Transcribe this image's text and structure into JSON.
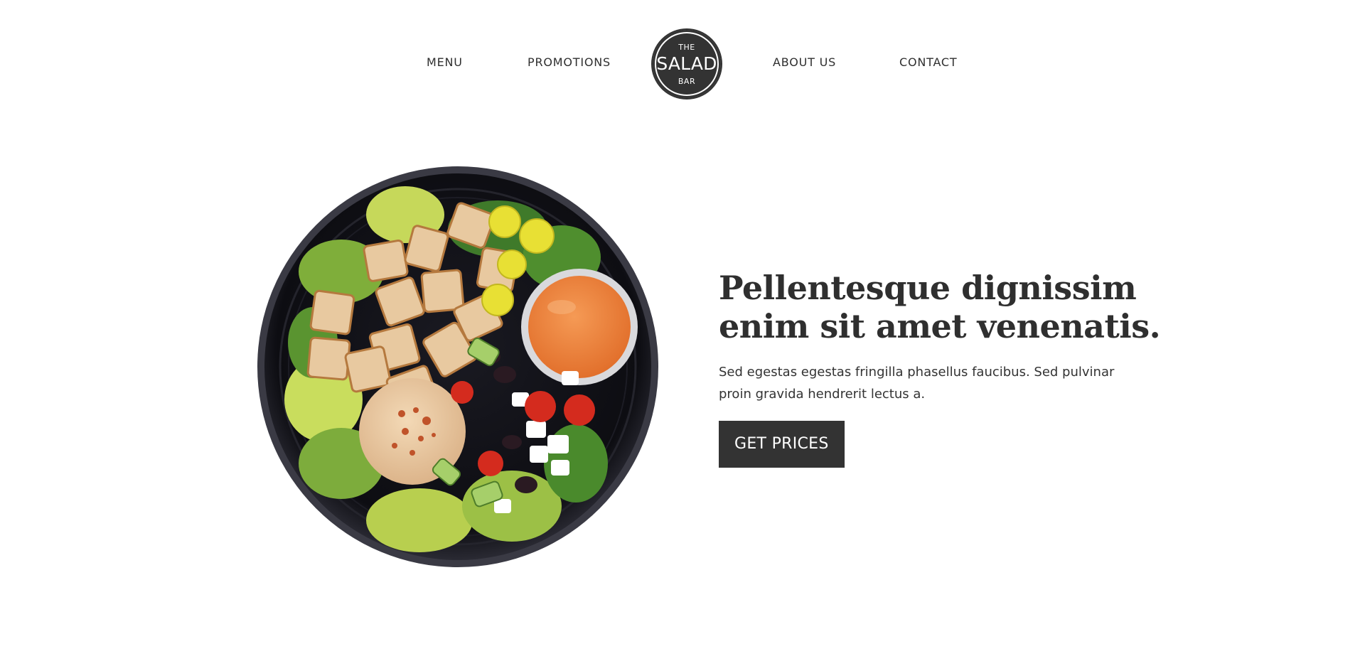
{
  "nav": {
    "items": [
      {
        "label": "MENU"
      },
      {
        "label": "PROMOTIONS"
      },
      {
        "label": "ABOUT US"
      },
      {
        "label": "CONTACT"
      }
    ],
    "logo": {
      "top": "THE",
      "middle": "SALAD",
      "bottom": "BAR"
    }
  },
  "hero": {
    "title_lines": [
      "Pellentesque dignissim",
      "enim sit amet venenatis."
    ],
    "description_lines": [
      "Sed egestas egestas fringilla phasellus faucibus. Sed pulvinar",
      "proin gravida hendrerit lectus a."
    ],
    "cta_label": "GET PRICES",
    "image_icon": "salad-bowl-image"
  },
  "colors": {
    "text": "#2f2f2f",
    "button_bg": "#333333",
    "logo_bg": "#333333",
    "background": "#ffffff"
  }
}
